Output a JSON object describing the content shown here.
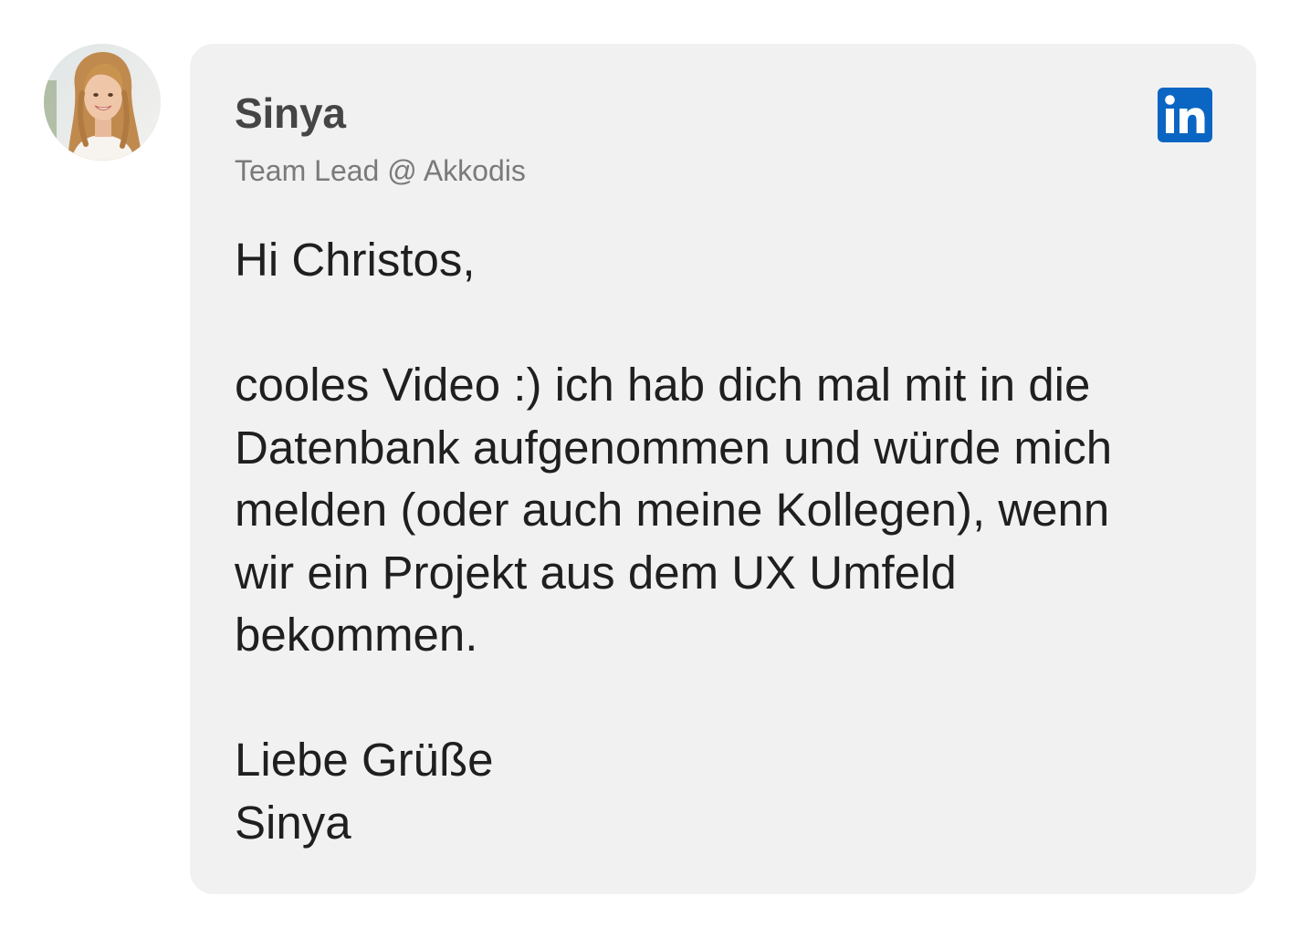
{
  "sender": {
    "name": "Sinya",
    "role": "Team Lead @ Akkodis",
    "avatar_icon": "profile-photo",
    "social_icon": "linkedin-icon",
    "social_color": "#0A66C2"
  },
  "message": {
    "greeting": "Hi Christos,",
    "line_1": "cooles Video :) ich hab dich mal mit in die",
    "line_2": "Datenbank aufgenommen und würde mich",
    "line_3": "melden (oder auch meine Kollegen), wenn",
    "line_4": "wir ein Projekt aus dem UX Umfeld",
    "line_5": "bekommen.",
    "closing": "Liebe Grüße",
    "signature": "Sinya"
  },
  "colors": {
    "card_background": "#f1f1f1",
    "name_color": "#454545",
    "role_color": "#7a7a7a",
    "body_color": "#1f1f1f"
  }
}
